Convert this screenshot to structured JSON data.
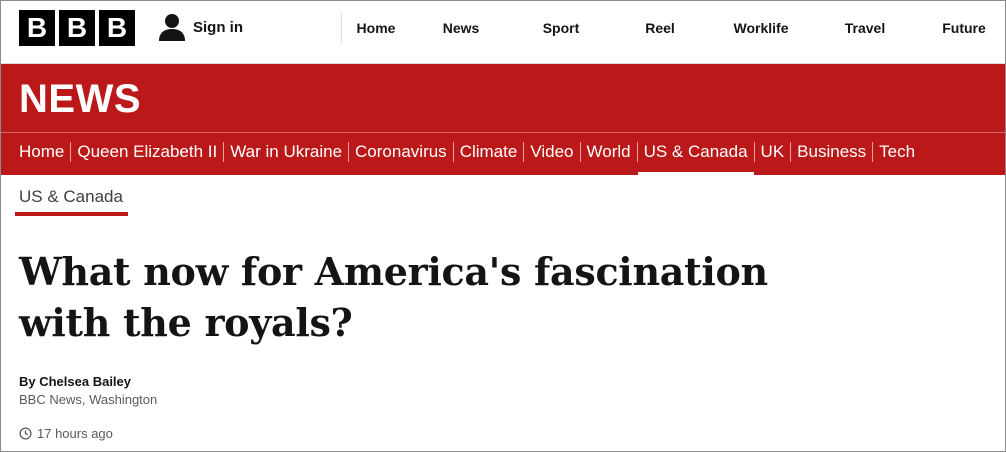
{
  "logo": [
    "B",
    "B",
    "B"
  ],
  "header": {
    "sign_in": "Sign in",
    "nav": [
      "Home",
      "News",
      "Sport",
      "Reel",
      "Worklife",
      "Travel",
      "Future"
    ]
  },
  "news_band": {
    "title": "NEWS",
    "sections": [
      "Home",
      "Queen Elizabeth II",
      "War in Ukraine",
      "Coronavirus",
      "Climate",
      "Video",
      "World",
      "US & Canada",
      "UK",
      "Business",
      "Tech"
    ],
    "active_section": "US & Canada"
  },
  "subsection": "US & Canada",
  "article": {
    "headline_line1": "What now for America's fascination",
    "headline_line2": "with the royals?",
    "author": "By Chelsea Bailey",
    "role": "BBC News, Washington",
    "timestamp": "17 hours ago"
  },
  "colors": {
    "brand_red": "#bb1919",
    "text": "#141414",
    "muted": "#5a5a5a"
  },
  "icons": [
    "user-icon",
    "clock-icon"
  ]
}
